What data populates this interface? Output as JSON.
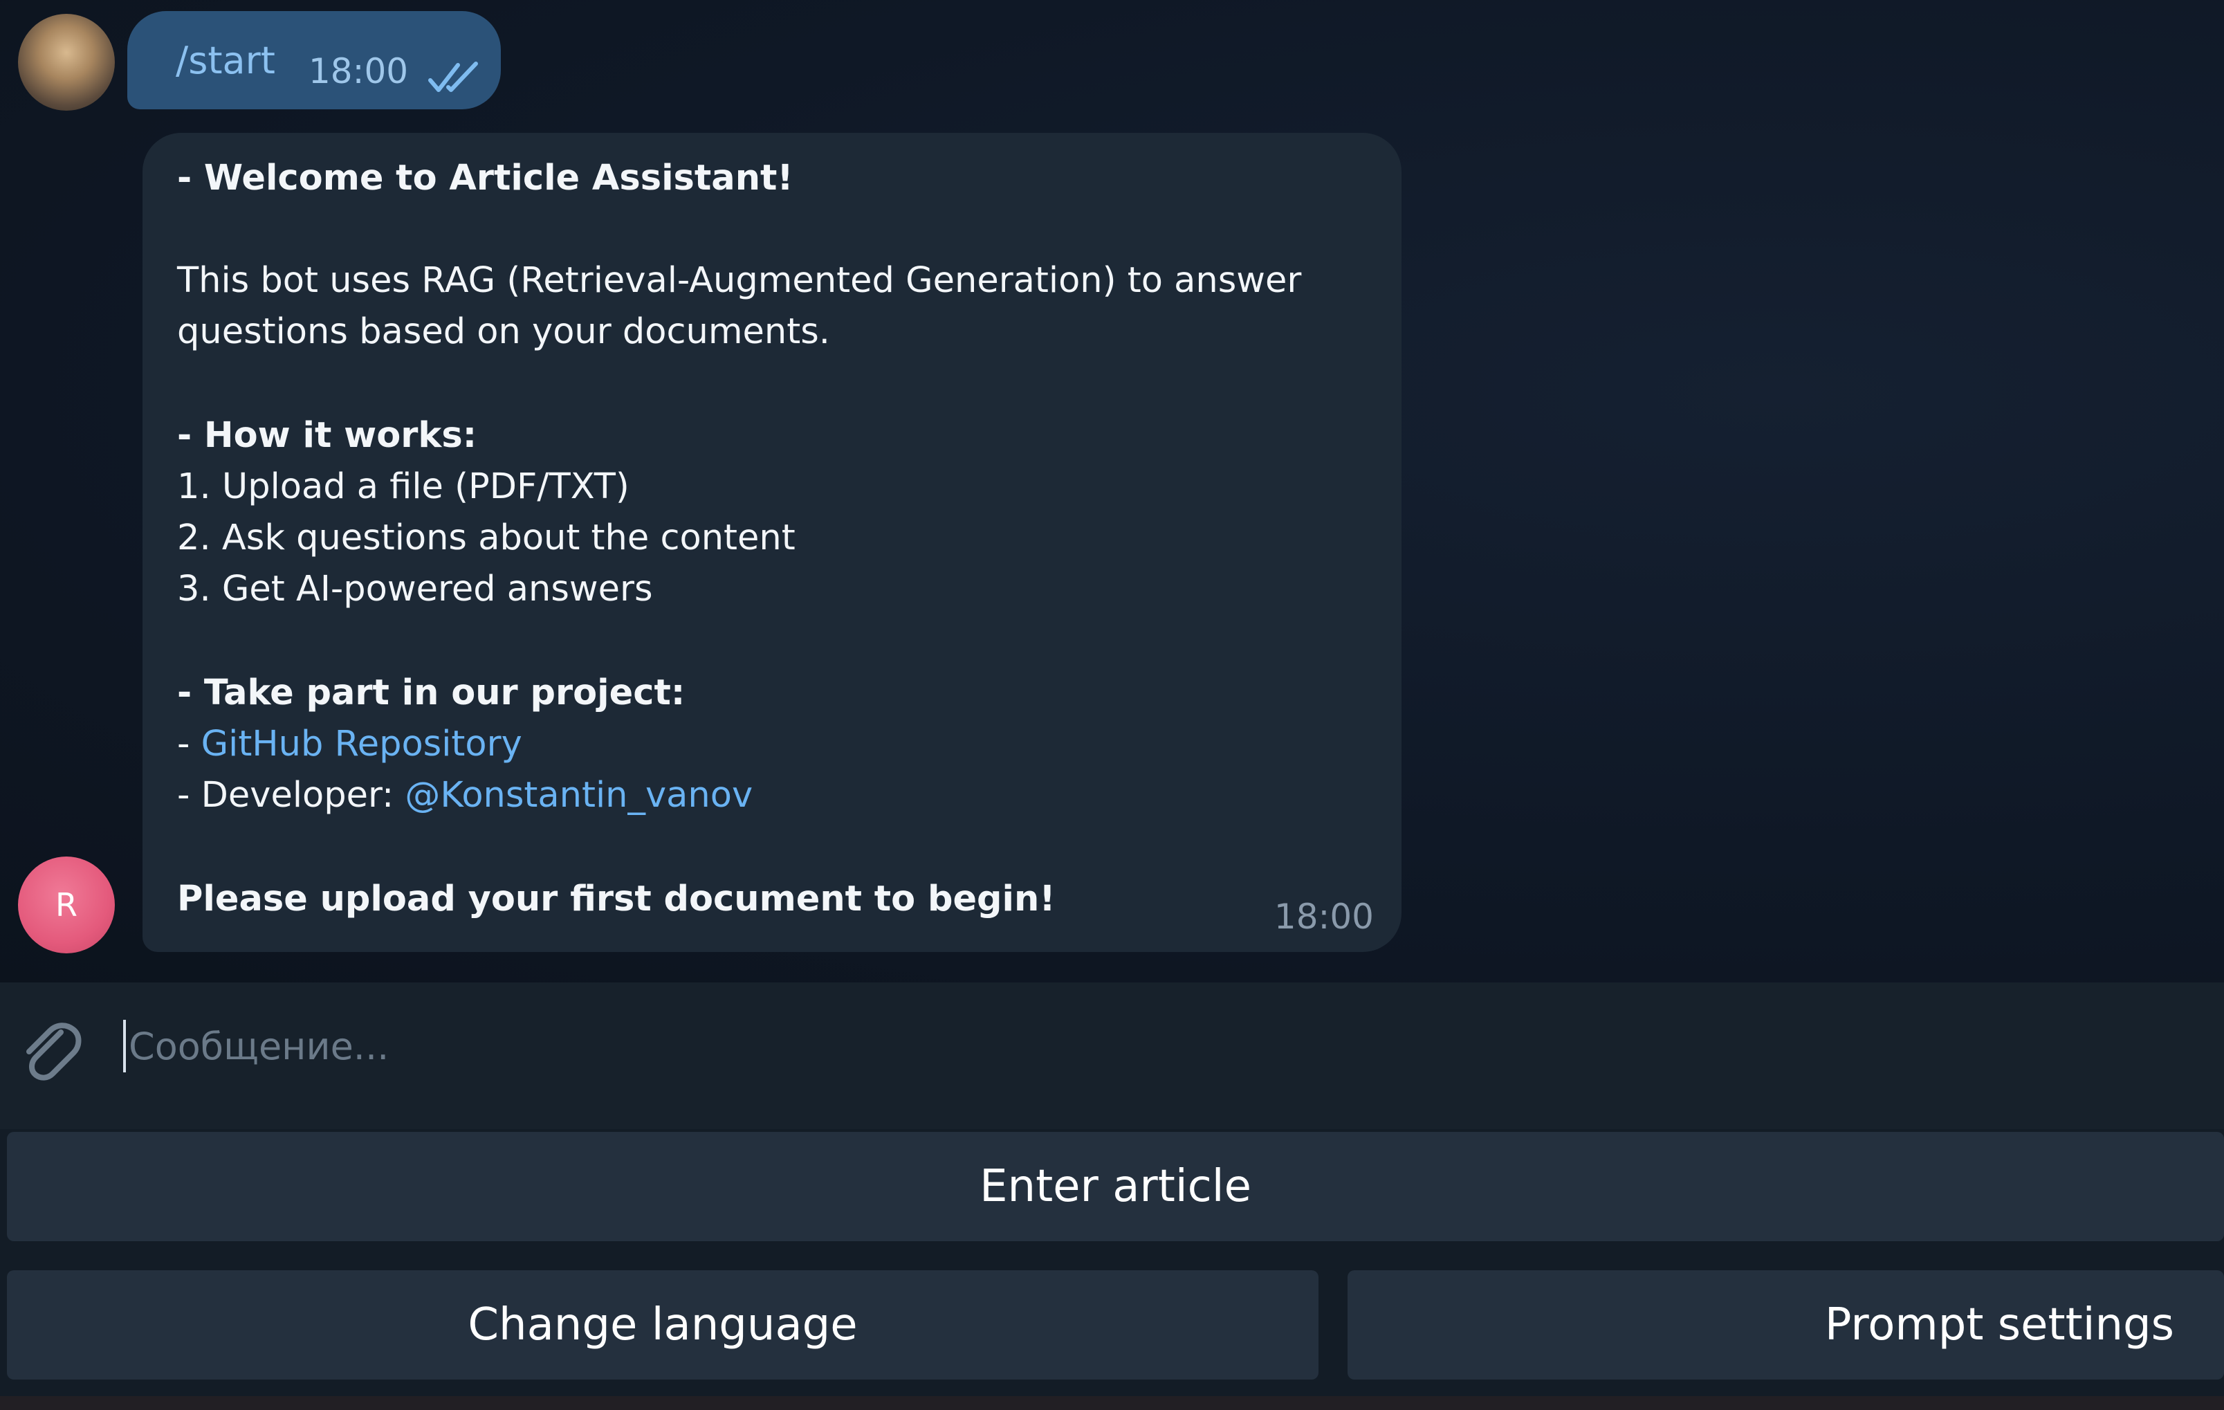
{
  "chat": {
    "outgoing": {
      "text": "/start",
      "time": "18:00",
      "status_icon": "double-check-icon"
    },
    "incoming": {
      "lines": [
        {
          "text": "- Welcome to Article Assistant!",
          "style": "bold"
        },
        {
          "text": "This bot uses RAG (Retrieval-Augmented Generation) to answer",
          "style": "normal"
        },
        {
          "text": "questions based on your documents.",
          "style": "normal"
        },
        {
          "text": "- How it works:",
          "style": "bold"
        },
        {
          "text": "1. Upload a file (PDF/TXT)",
          "style": "normal"
        },
        {
          "text": "2. Ask questions about the content",
          "style": "normal"
        },
        {
          "text": "3. Get AI-powered answers",
          "style": "normal"
        },
        {
          "text": "- Take part in our project:",
          "style": "bold"
        },
        {
          "prefix": "- ",
          "link": "GitHub Repository"
        },
        {
          "prefix": "- Developer: ",
          "link": "@Konstantin_vanov"
        },
        {
          "text": "Please upload your first document to begin!",
          "style": "bold"
        }
      ],
      "time": "18:00"
    },
    "bot_avatar_letter": "R"
  },
  "input": {
    "placeholder": "Сообщение...",
    "value": "",
    "attach_icon": "paperclip-icon"
  },
  "keyboard": {
    "enter_article": "Enter article",
    "change_language": "Change language",
    "prompt_settings": "Prompt settings"
  },
  "colors": {
    "background": "#0e1621",
    "outgoing_bubble": "#2b5278",
    "incoming_bubble": "#1d2936",
    "link": "#6ab3f3",
    "keyboard_button": "#24303e"
  }
}
